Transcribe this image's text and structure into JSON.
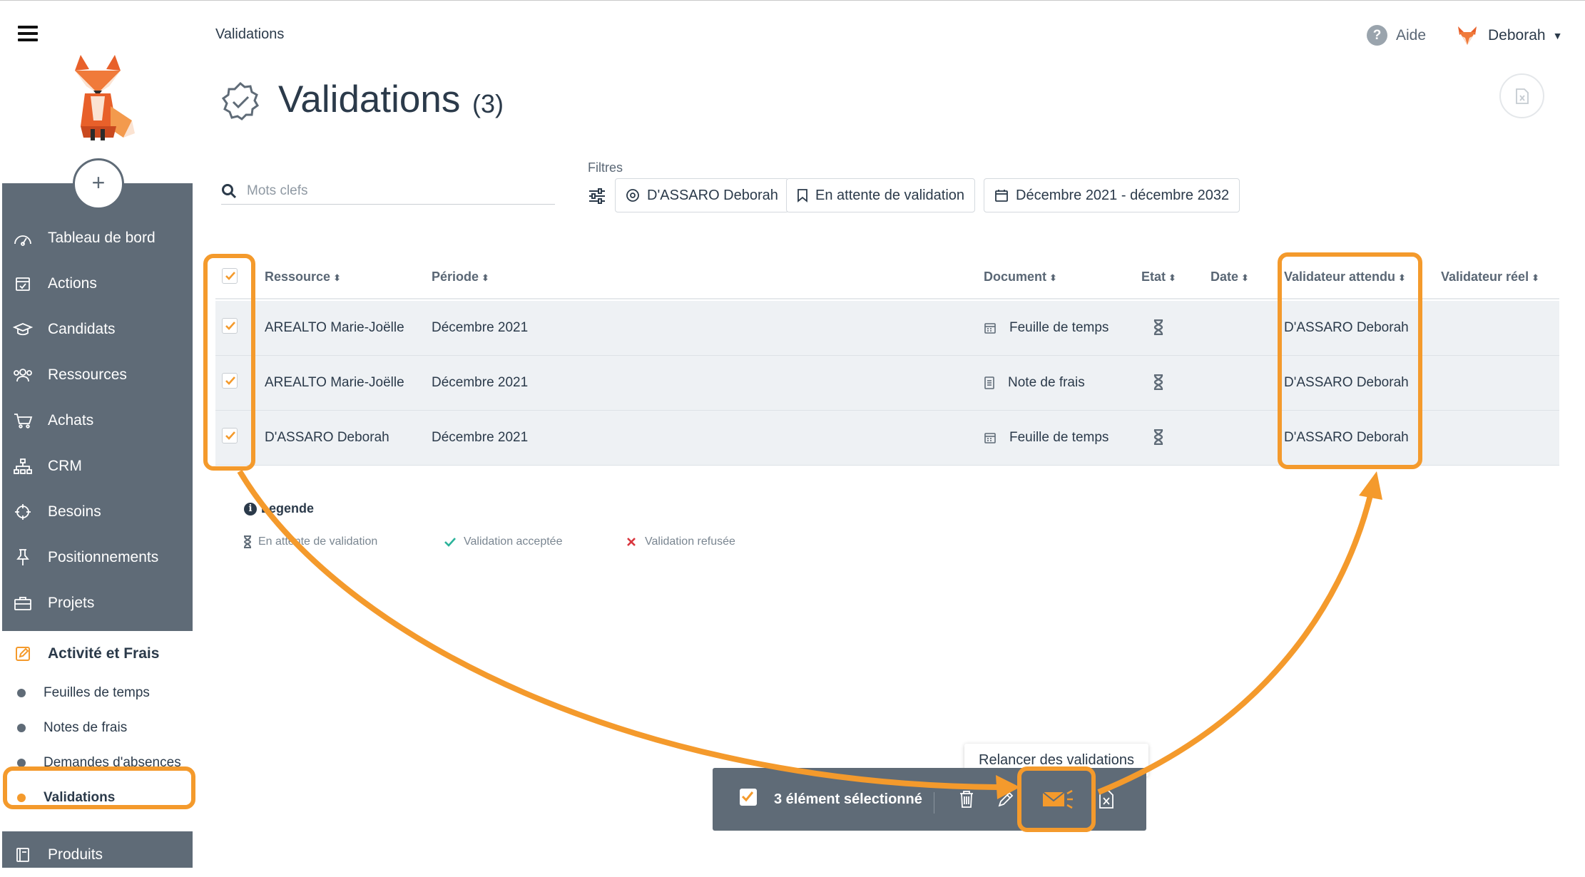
{
  "breadcrumb": "Validations",
  "header": {
    "help_label": "Aide",
    "user_name": "Deborah"
  },
  "page": {
    "title": "Validations",
    "count": "(3)"
  },
  "search": {
    "placeholder": "Mots clefs"
  },
  "filters": {
    "label": "Filtres",
    "chips": [
      "D'ASSARO Deborah",
      "En attente de validation",
      "Décembre 2021 - décembre 2032"
    ]
  },
  "sidebar": {
    "items": [
      {
        "label": "Tableau de bord",
        "icon": "dashboard-icon"
      },
      {
        "label": "Actions",
        "icon": "calendar-check-icon"
      },
      {
        "label": "Candidats",
        "icon": "graduation-cap-icon"
      },
      {
        "label": "Ressources",
        "icon": "users-icon"
      },
      {
        "label": "Achats",
        "icon": "cart-icon"
      },
      {
        "label": "CRM",
        "icon": "hierarchy-icon"
      },
      {
        "label": "Besoins",
        "icon": "crosshair-icon"
      },
      {
        "label": "Positionnements",
        "icon": "pin-icon"
      },
      {
        "label": "Projets",
        "icon": "briefcase-icon"
      },
      {
        "label": "Activité et Frais",
        "icon": "edit-icon"
      }
    ],
    "submenu": [
      "Feuilles de temps",
      "Notes de frais",
      "Demandes d'absences",
      "Validations"
    ],
    "last_item": {
      "label": "Produits",
      "icon": "book-icon"
    }
  },
  "table": {
    "columns": [
      "Ressource",
      "Période",
      "Document",
      "Etat",
      "Date",
      "Validateur attendu",
      "Validateur réel"
    ],
    "rows": [
      {
        "ressource": "AREALTO Marie-Joëlle",
        "periode": "Décembre 2021",
        "document": "Feuille de temps",
        "doc_icon": "calendar-icon",
        "etat_icon": "hourglass-icon",
        "date": "",
        "validateur_attendu": "D'ASSARO Deborah",
        "validateur_reel": ""
      },
      {
        "ressource": "AREALTO Marie-Joëlle",
        "periode": "Décembre 2021",
        "document": "Note de frais",
        "doc_icon": "receipt-icon",
        "etat_icon": "hourglass-icon",
        "date": "",
        "validateur_attendu": "D'ASSARO Deborah",
        "validateur_reel": ""
      },
      {
        "ressource": "D'ASSARO Deborah",
        "periode": "Décembre 2021",
        "document": "Feuille de temps",
        "doc_icon": "calendar-icon",
        "etat_icon": "hourglass-icon",
        "date": "",
        "validateur_attendu": "D'ASSARO Deborah",
        "validateur_reel": ""
      }
    ]
  },
  "legend": {
    "title": "Legende",
    "items": [
      "En attente de validation",
      "Validation acceptée",
      "Validation refusée"
    ]
  },
  "action_bar": {
    "selection_label": "3 élément sélectionné",
    "tooltip": "Relancer des validations"
  },
  "colors": {
    "accent": "#f49a2c",
    "sidebar": "#5f6b77",
    "text": "#2b3a4a",
    "accepted": "#2bb39a",
    "refused": "#d9363e"
  }
}
